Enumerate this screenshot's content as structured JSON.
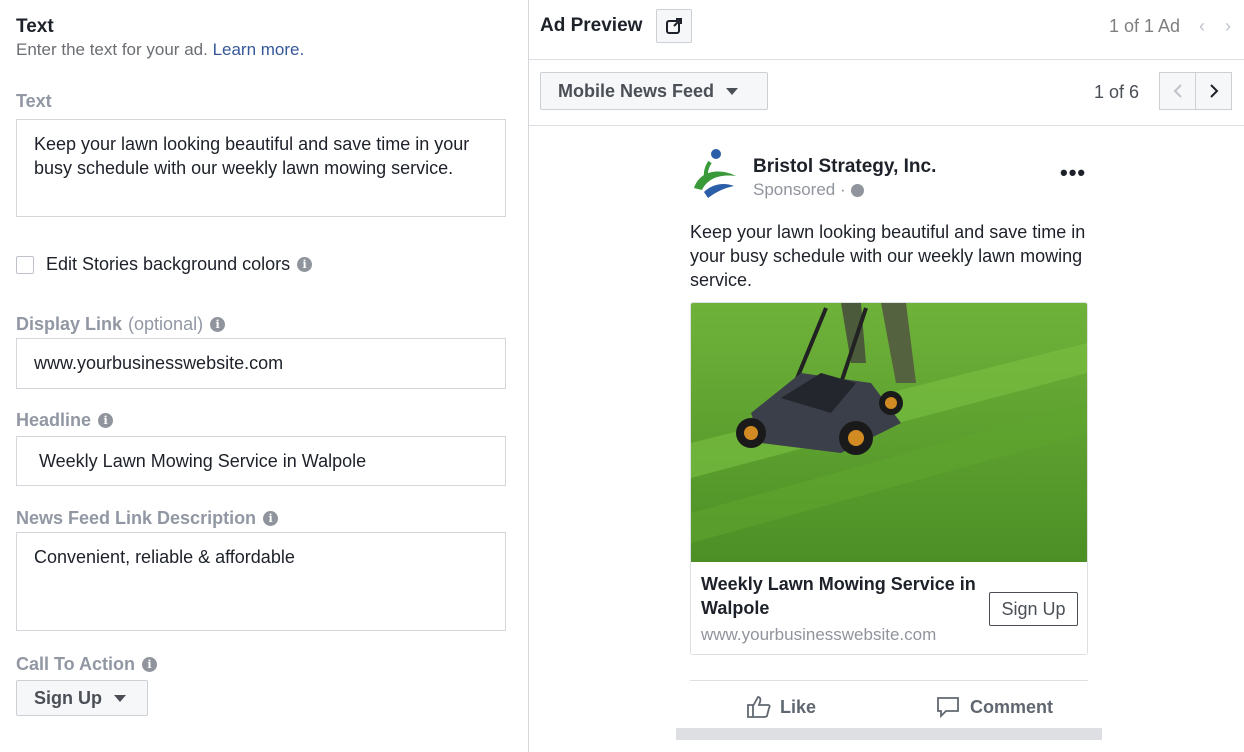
{
  "text_section": {
    "title": "Text",
    "subtitle": "Enter the text for your ad.",
    "learn_more": "Learn more."
  },
  "fields": {
    "text_label": "Text",
    "text_value": "Keep your lawn looking beautiful and save time in your busy schedule with our weekly lawn mowing service.",
    "stories_checkbox_label": "Edit Stories background colors",
    "display_link_label": "Display Link",
    "display_link_optional": "(optional)",
    "display_link_value": "www.yourbusinesswebsite.com",
    "headline_label": "Headline",
    "headline_value": "Weekly Lawn Mowing Service in Walpole",
    "description_label": "News Feed Link Description",
    "description_value": "Convenient, reliable & affordable",
    "cta_label": "Call To Action",
    "cta_value": "Sign Up"
  },
  "preview": {
    "title": "Ad Preview",
    "ad_count": "1 of 1 Ad",
    "placement": "Mobile News Feed",
    "position": "1 of 6"
  },
  "ad": {
    "page_name": "Bristol Strategy, Inc.",
    "sponsored": "Sponsored ·",
    "body": "Keep your lawn looking beautiful and save time in your busy schedule with our weekly lawn mowing service.",
    "headline": "Weekly Lawn Mowing Service in Walpole",
    "link": "www.yourbusinesswebsite.com",
    "cta": "Sign Up",
    "like": "Like",
    "comment": "Comment"
  },
  "colors": {
    "link_blue": "#365899",
    "label_gray": "#9197a3",
    "grass_green": "#5a9a2c"
  }
}
